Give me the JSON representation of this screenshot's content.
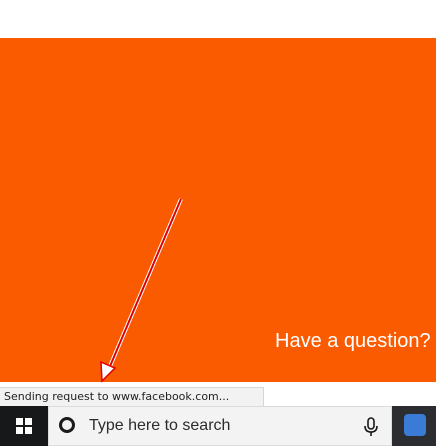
{
  "page": {
    "question_text": "Have a question?"
  },
  "status_bar": {
    "text": "Sending request to www.facebook.com..."
  },
  "taskbar": {
    "start_icon": "windows-logo-icon",
    "search_placeholder": "Type here to search",
    "search_icon": "cortana-icon",
    "mic_icon": "microphone-icon",
    "tray_icon": "app-tray-icon"
  },
  "colors": {
    "hero_background": "#fa5a00",
    "taskbar_background": "#17181a",
    "arrow_color": "#e00000"
  }
}
